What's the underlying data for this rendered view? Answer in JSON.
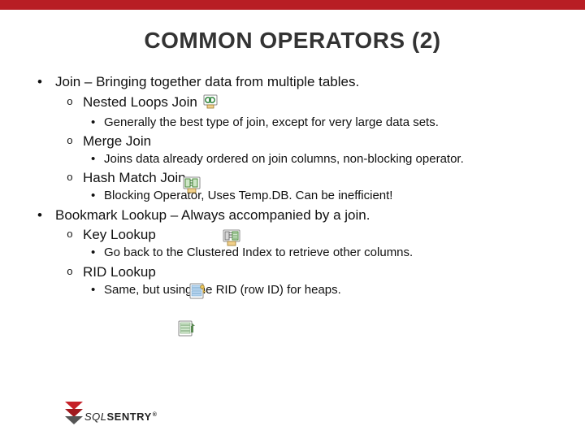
{
  "title": "COMMON OPERATORS (2)",
  "top": {
    "join": "Join – Bringing together data from multiple tables.",
    "nested": "Nested Loops Join",
    "nested_sub": "Generally the best type of join, except for very large data sets.",
    "merge": "Merge Join",
    "merge_sub": "Joins data already ordered on join columns, non-blocking operator.",
    "hash": "Hash Match Join",
    "hash_sub": "Blocking Operator, Uses Temp.DB.  Can be inefficient!",
    "bookmark": "Bookmark Lookup – Always accompanied by a join.",
    "key": "Key Lookup",
    "key_sub": "Go back to the Clustered Index to retrieve other columns.",
    "rid": "RID Lookup",
    "rid_sub": "Same, but using the RID (row ID) for heaps."
  },
  "logo": {
    "sql": "SQL",
    "sentry": "SENTRY",
    "reg": "®"
  },
  "icons": {
    "nested": "nested-loops-icon",
    "merge": "merge-join-icon",
    "hash": "hash-match-icon",
    "key": "key-lookup-icon",
    "rid": "rid-lookup-icon"
  }
}
